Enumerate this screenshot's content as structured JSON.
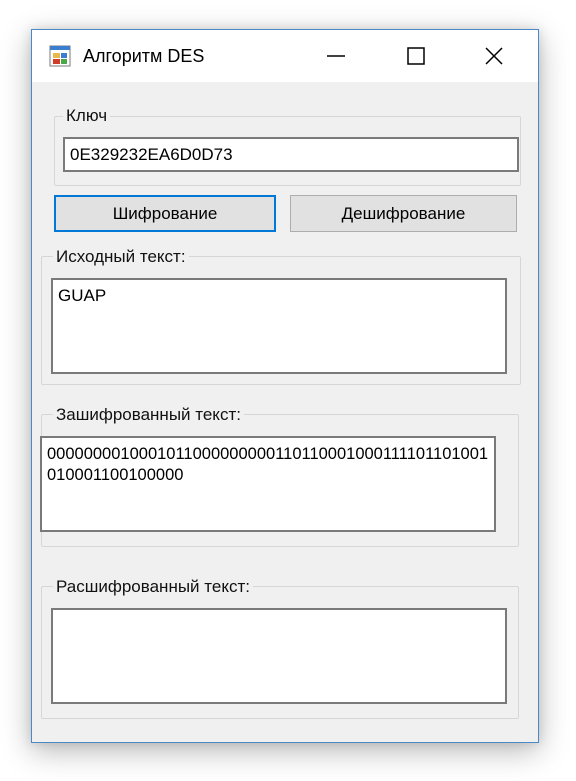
{
  "window": {
    "title": "Алгоритм DES",
    "icon": "app-form-icon",
    "controls": {
      "minimize": "minimize-icon",
      "maximize": "maximize-icon",
      "close": "close-icon"
    }
  },
  "key_group": {
    "label": "Ключ",
    "value": "0E329232EA6D0D73"
  },
  "buttons": {
    "encrypt": "Шифрование",
    "decrypt": "Дешифрование"
  },
  "source_group": {
    "label": "Исходный текст:",
    "value": "GUAP"
  },
  "encrypted_group": {
    "label": "Зашифрованный текст:",
    "value": "0000000010001011000000000110110001000111101101001010001100100000"
  },
  "decrypted_group": {
    "label": "Расшифрованный текст:",
    "value": ""
  },
  "colors": {
    "window_border": "#4a88c7",
    "focus_accent": "#0078d7",
    "window_bg": "#f0f0f0"
  }
}
